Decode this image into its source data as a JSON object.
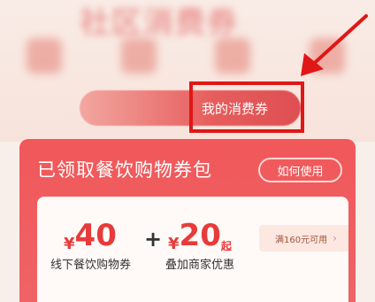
{
  "header": {
    "blurred_title": "社区消费券"
  },
  "top": {
    "my_coupons_label": "我的消费券"
  },
  "panel": {
    "title": "已领取餐饮购物券包",
    "how_to_use": "如何使用"
  },
  "coupon": {
    "currency": "¥",
    "amount1": "40",
    "desc1": "线下餐饮购物券",
    "plus": "+",
    "amount2": "20",
    "amount2_suffix": "起",
    "desc2": "叠加商家优惠",
    "side_label": "满160元可用",
    "side_chevron": "›"
  },
  "colors": {
    "accent_red": "#e73b3b",
    "annotation_red": "#e11616",
    "panel_red": "#f0585a"
  },
  "icons": {
    "annotation": "arrow-pointer-icon"
  }
}
